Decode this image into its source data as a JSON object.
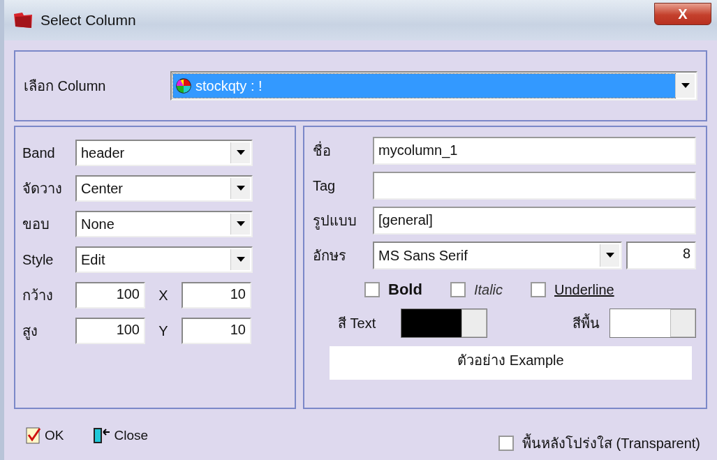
{
  "window": {
    "title": "Select Column",
    "close": "X"
  },
  "column_select": {
    "label": "เลือก Column",
    "value": "stockqty : !"
  },
  "left_fields": [
    {
      "label": "Band",
      "kind": "dropdown",
      "value": "header"
    },
    {
      "label": "จัดวาง",
      "kind": "dropdown",
      "value": "Center"
    },
    {
      "label": "ขอบ",
      "kind": "dropdown",
      "value": "None"
    },
    {
      "label": "Style",
      "kind": "dropdown",
      "value": "Edit"
    },
    {
      "label": "กว้าง",
      "kind": "pair",
      "value": "100",
      "label_2": "X",
      "value_2": "10"
    },
    {
      "label": "สูง",
      "kind": "pair",
      "value": "100",
      "label_2": "Y",
      "value_2": "10"
    }
  ],
  "right_fields": [
    {
      "label": "ชื่อ",
      "value": "mycolumn_1"
    },
    {
      "label": "Tag"
    },
    {
      "label": "รูปแบบ",
      "value": "[general]"
    }
  ],
  "font": {
    "label": "อักษร",
    "value": "MS Sans Serif",
    "size": "8"
  },
  "styles": [
    {
      "label": "Bold",
      "kind": "bold",
      "checked": false
    },
    {
      "label": "Italic",
      "kind": "italic",
      "checked": false
    },
    {
      "label": "Underline",
      "kind": "underline",
      "checked": false
    }
  ],
  "colors": [
    {
      "label": "สี Text",
      "color": "#000000"
    },
    {
      "label": "สีพื้น",
      "color": "#ffffff"
    }
  ],
  "preview": "ตัวอย่าง Example",
  "buttons": [
    {
      "label": "OK",
      "kind": "ok"
    },
    {
      "label": "Close",
      "kind": "close"
    }
  ],
  "transparent": {
    "label": "พื้นหลังโปร่งใส (Transparent)",
    "checked": false
  }
}
